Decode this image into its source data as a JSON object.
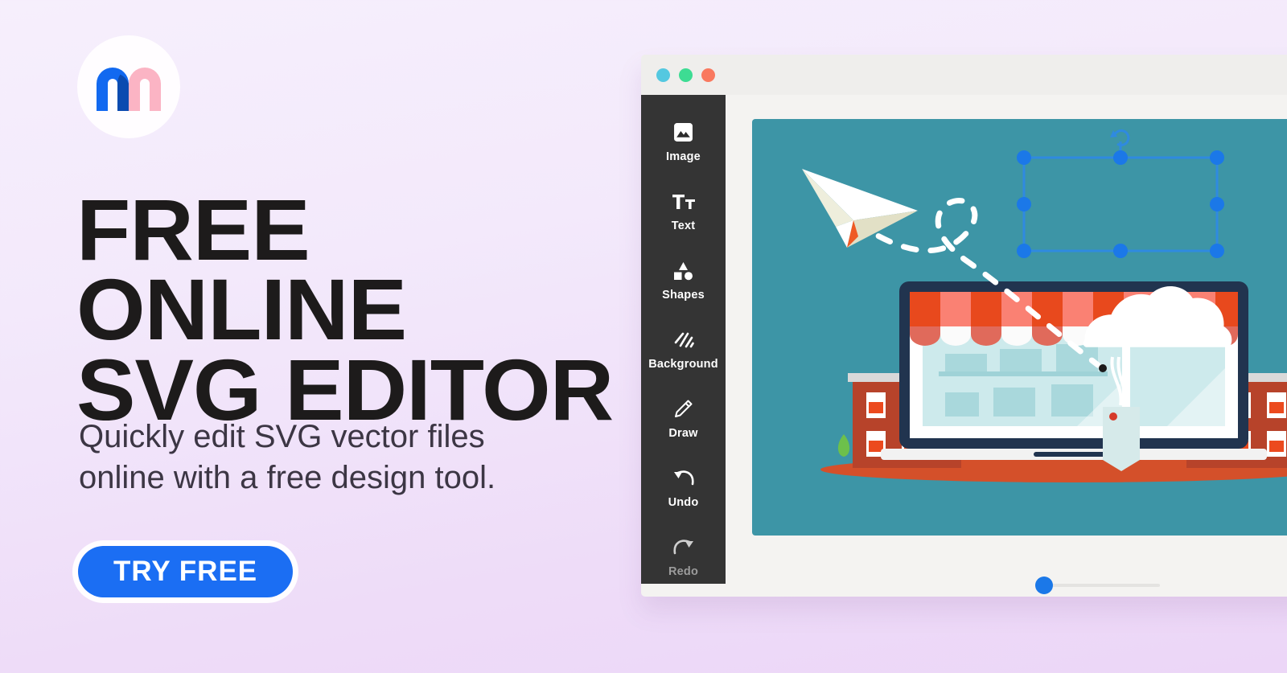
{
  "background": {
    "gradient_top": "#f6effc",
    "gradient_bottom": "#ecd6f7"
  },
  "promo": {
    "logo": {
      "icon": "m-arch-logo",
      "badge_color": "#fffdff",
      "left_arch_color": "#1269f0",
      "right_arch_color": "#fbb4c4",
      "overlap_color": "#0b4bb0"
    },
    "headline": "FREE ONLINE\nSVG EDITOR",
    "headline_color": "#1d1b1b",
    "subtitle": "Quickly edit SVG vector files\nonline with a free design tool.",
    "subtitle_color": "#3c3644",
    "cta": {
      "label": "TRY FREE",
      "background": "#1b6ef3",
      "text_color": "#ffffff",
      "ring_color": "#fffdff"
    }
  },
  "app_window": {
    "titlebar": {
      "background": "#efeeec",
      "dots": [
        {
          "name": "window-dot-cyan",
          "color": "#54c8e0"
        },
        {
          "name": "window-dot-green",
          "color": "#3ddc93"
        },
        {
          "name": "window-dot-red",
          "color": "#f9795f"
        }
      ]
    },
    "sidebar": {
      "background": "#343434",
      "items": [
        {
          "label": "Image",
          "icon": "image-icon",
          "muted": false
        },
        {
          "label": "Text",
          "icon": "text-icon",
          "muted": false
        },
        {
          "label": "Shapes",
          "icon": "shapes-icon",
          "muted": false
        },
        {
          "label": "Background",
          "icon": "background-icon",
          "muted": false
        },
        {
          "label": "Draw",
          "icon": "pencil-icon",
          "muted": false
        },
        {
          "label": "Undo",
          "icon": "undo-arrow-icon",
          "muted": false
        },
        {
          "label": "Redo",
          "icon": "redo-arrow-icon",
          "muted": true
        }
      ]
    },
    "canvas": {
      "background": "#3d95a6",
      "artwork_name": "storefront-laptop-illustration",
      "elements": [
        {
          "name": "paper-plane",
          "color": "#ffffff",
          "accent": "#ef5a24"
        },
        {
          "name": "dashed-flight-path",
          "color": "#ffffff"
        },
        {
          "name": "laptop",
          "bezel_color": "#21344f",
          "base_color": "#f2f2f2"
        },
        {
          "name": "shop-awning",
          "stripe_dark": "#e8491d",
          "stripe_light": "#fa8173"
        },
        {
          "name": "shop-window",
          "color": "#cdeaec"
        },
        {
          "name": "brick-building-left",
          "color": "#b7432a"
        },
        {
          "name": "brick-building-right",
          "color": "#b7432a"
        },
        {
          "name": "ground-ellipse",
          "color": "#d4502a"
        },
        {
          "name": "cloud-shape",
          "color": "#ffffff"
        },
        {
          "name": "price-tag",
          "color": "#d6eaea"
        },
        {
          "name": "leaf",
          "color": "#6dc04b"
        },
        {
          "name": "cursor-dot",
          "color": "#1b1b1b"
        }
      ],
      "selection": {
        "name": "cloud-selection-box",
        "handle_color": "#1b78e8",
        "border_color": "#2f8ae0",
        "handle_count": 8,
        "rotate_handle": true
      }
    },
    "zoom_slider": {
      "track_color": "#e4e3e1",
      "thumb_color": "#1b78e8",
      "value_percent": 8
    }
  }
}
